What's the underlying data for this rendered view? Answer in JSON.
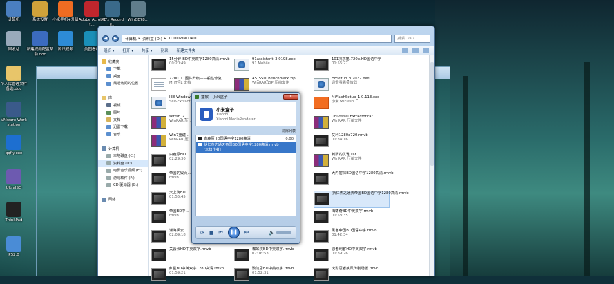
{
  "desktop_icons": [
    {
      "label": "计算机"
    },
    {
      "label": "系统设置"
    },
    {
      "label": "小米手机+升级"
    },
    {
      "label": "Adobe Acrobat..."
    },
    {
      "label": "PE'z Recorde..."
    },
    {
      "label": "WinCE78..."
    },
    {
      "label": "回收站"
    },
    {
      "label": "新建视频配置帮助.doc"
    },
    {
      "label": "腾讯视频"
    },
    {
      "label": "美图看看"
    },
    {
      "label": "个人库管理文件备选.doc"
    },
    {
      "label": "VMware Workstation"
    },
    {
      "label": "qqfly.exe"
    },
    {
      "label": "UltraISO"
    },
    {
      "label": "ThinkPad"
    },
    {
      "label": "PS2.0"
    }
  ],
  "explorer": {
    "address": [
      "计算机",
      "资料盘 (D:)",
      "TDDOWNLOAD"
    ],
    "search_placeholder": "搜索 TDD...",
    "toolbar": [
      "组织 ▾",
      "打开 ▾",
      "共享 ▾",
      "刻录",
      "新建文件夹"
    ],
    "nav": [
      {
        "label": "收藏夹",
        "color": "#e8b94a"
      },
      {
        "label": "下载",
        "color": "#5b8fcf"
      },
      {
        "label": "桌面",
        "color": "#5b8fcf"
      },
      {
        "label": "最近访问的位置",
        "color": "#5b8fcf"
      },
      {
        "label": "",
        "color": ""
      },
      {
        "label": "库",
        "color": "#e8c56a"
      },
      {
        "label": "视频",
        "color": "#5b6e8a"
      },
      {
        "label": "图片",
        "color": "#5b8f5a"
      },
      {
        "label": "文档",
        "color": "#d6b35a"
      },
      {
        "label": "迅雷下载",
        "color": "#5b8fcf"
      },
      {
        "label": "音乐",
        "color": "#5b8fcf"
      },
      {
        "label": "",
        "color": ""
      },
      {
        "label": "计算机",
        "color": "#6a8bb0"
      },
      {
        "label": "本地磁盘 (C:)",
        "color": "#9aa"
      },
      {
        "label": "资料盘 (D:)",
        "color": "#9aa"
      },
      {
        "label": "电影音乐视频 (E:)",
        "color": "#9aa"
      },
      {
        "label": "游戏软件 (F:)",
        "color": "#9aa"
      },
      {
        "label": "CD 驱动器 (G:)",
        "color": "#9aa"
      },
      {
        "label": "",
        "color": ""
      },
      {
        "label": "网络",
        "color": "#6a8bb0"
      }
    ],
    "col1": [
      {
        "name": "15分钟-BD中英双字1280高清.rmvb",
        "sub": "00:20:49",
        "type": "video"
      },
      {
        "name": "7200_11固件升级——般性修复",
        "sub": "MHTML 文档",
        "type": "doc"
      },
      {
        "name": "IE8-Windows...",
        "sub": "Self-Extract...",
        "type": "app"
      },
      {
        "name": "setfsb_2_...",
        "sub": "WinRAR 压...",
        "type": "rar"
      },
      {
        "name": "Win7重建...",
        "sub": "WinRAR 压...",
        "type": "rar"
      },
      {
        "name": "白鹿原HD...",
        "sub": "02:29:30",
        "type": "video"
      },
      {
        "name": "帝国的毁灭...",
        "sub": "rmvb",
        "type": "video"
      },
      {
        "name": "大上海BD...",
        "sub": "01:55:45",
        "type": "video"
      },
      {
        "name": "帝国BD中...",
        "sub": "rmvb",
        "type": "video"
      },
      {
        "name": "谍海风云...",
        "sub": "02:09:18",
        "type": "video"
      },
      {
        "name": "关云长HD中英双字.rmvb",
        "sub": "",
        "type": "video"
      },
      {
        "name": "红星BD中英双字1280高清.rmvb",
        "sub": "01:59:21",
        "type": "video"
      }
    ],
    "col2": [
      {
        "name": "91assistant_3.0198.exe",
        "sub": "91 Mobile",
        "type": "app"
      },
      {
        "name": "AS_SSD_Benchmark.zip",
        "sub": "WinRAR ZIP 压缩文件",
        "type": "rar"
      },
      {
        "name": "",
        "sub": "",
        "type": ""
      },
      {
        "name": "",
        "sub": "",
        "type": ""
      },
      {
        "name": "",
        "sub": "",
        "type": ""
      },
      {
        "name": "",
        "sub": "",
        "type": ""
      },
      {
        "name": "",
        "sub": "",
        "type": ""
      },
      {
        "name": "",
        "sub": "",
        "type": ""
      },
      {
        "name": "",
        "sub": "",
        "type": ""
      },
      {
        "name": "",
        "sub": "",
        "type": ""
      },
      {
        "name": "蜘蛛侠BD中英双字.rmvb",
        "sub": "02:16:53",
        "type": "video"
      },
      {
        "name": "致沉思BD中英双字.rmvb",
        "sub": "01:52:31",
        "type": "video"
      }
    ],
    "col3": [
      {
        "name": "101次求婚.720p.HD国语中字",
        "sub": "01:56:27",
        "type": "video"
      },
      {
        "name": "HFSetup_3.7022.exe",
        "sub": "迅雷看看播放器",
        "type": "app"
      },
      {
        "name": "MiFlashSetup_1.0.113.exe",
        "sub": "小米 MiFlash",
        "type": "mi"
      },
      {
        "name": "Universal Extractor.rar",
        "sub": "WinRAR 压缩文件",
        "type": "rar"
      },
      {
        "name": "艾利1280x720.rmvb",
        "sub": "01:34:16",
        "type": "video"
      },
      {
        "name": "刺猬的优雅.rar",
        "sub": "WinRAR 压缩文件",
        "type": "rar"
      },
      {
        "name": "大内密探BD国语中字1280高清.rmvb",
        "sub": "",
        "type": "video"
      },
      {
        "name": "狄仁杰之通天帝国BD国语中字1280高清.rmvb",
        "sub": "",
        "type": "video"
      },
      {
        "name": "海啸奇BD中英双字.rmvb",
        "sub": "01:58:35",
        "type": "video"
      },
      {
        "name": "黑客帝国BD国语中字.rmvb",
        "sub": "01:42:34",
        "type": "video"
      },
      {
        "name": "忍者刺客HD中英双字.rmvb",
        "sub": "01:39:26",
        "type": "video"
      },
      {
        "name": "火影忍者疾风传剧场版.rmvb",
        "sub": "",
        "type": "video"
      }
    ]
  },
  "player": {
    "title": "播放 - 小米盒子",
    "device_name": "小米盒子",
    "device_sub1": "Xiaomi",
    "device_sub2": "Xiaomi MediaRenderer",
    "clear_label": "清除列表",
    "playlist": [
      {
        "name": "白鹿原HD国语中字1280高清",
        "duration": "0:00"
      },
      {
        "name": "狄仁杰之通天帝国BD国语中字1280高清.rmvb",
        "sub": "[未知作者]"
      }
    ]
  }
}
